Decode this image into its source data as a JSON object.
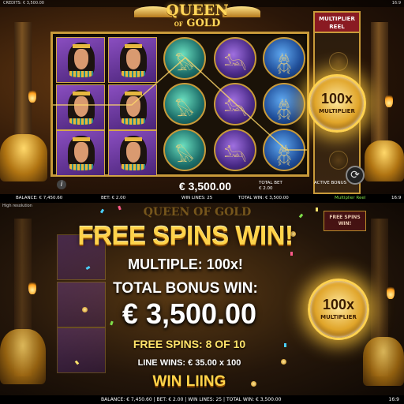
{
  "top_panel": {
    "credits_label": "CREDITS: € 3,500.00",
    "aspect_ratio": "16:9",
    "logo": {
      "line1": "QUEEN",
      "of": "OF",
      "line2": "GOLD"
    },
    "multiplier_reel": {
      "title": "MULTIPLIER REEL",
      "multiplier": "100x",
      "sub_label": "MULTIPLIER"
    },
    "reels": {
      "columns": [
        [
          "queen",
          "queen",
          "queen"
        ],
        [
          "queen",
          "queen",
          "queen"
        ],
        [
          "horus",
          "horus",
          "horus"
        ],
        [
          "anubis",
          "anubis",
          "anubis"
        ],
        [
          "scarab",
          "scarab",
          "scarab"
        ]
      ]
    },
    "info_icon": "info-icon",
    "win_amount": "€ 3,500.00",
    "total_bet_label": "TOTAL BET",
    "total_bet_value": "€ 2.00",
    "active_bonus": "ACTIVE BONUS",
    "spin_icon": "refresh-icon",
    "status_bar": {
      "balance": "BALANCE: € 7,450.60",
      "bet": "BET: € 2.00",
      "win_lines": "WIN LINES: 25",
      "total_win": "TOTAL WIN: € 3,500.00",
      "mode": "Multiplier Reel",
      "ratio": "16:9"
    }
  },
  "bottom_panel": {
    "resolution_label": "High resolution",
    "ghost_logo": "QUEEN OF GOLD",
    "ghost_reel": "FREE SPINS WIN!",
    "headline": "FREE SPINS WIN!",
    "multiple": "MULTIPLE: 100x!",
    "total_bonus_label": "TOTAL BONUS WIN:",
    "total_bonus_amount": "€ 3,500.00",
    "free_spins": "FREE SPINS: 8 OF 10",
    "line_wins": "LINE WINS: € 35.00 x 100",
    "win_lining": "WIN LIING",
    "coin": {
      "multiplier": "100x",
      "sub_label": "MULTIPLIER"
    },
    "status_bar": "BALANCE: € 7,450.60 | BET: € 2.00 | WIN LINES: 25 | TOTAL WIN: € 3,500.00",
    "ratio": "16:9"
  },
  "colors": {
    "gold": "#ffd34a",
    "frame": "#c89a3a",
    "multiplier_header": "#8a1a22",
    "mode_green": "#7fe04a"
  }
}
